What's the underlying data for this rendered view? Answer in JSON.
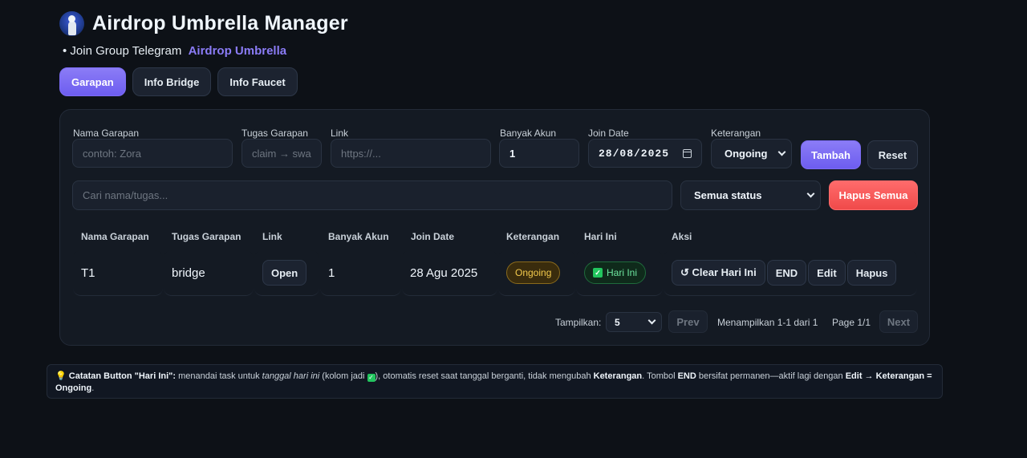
{
  "app": {
    "title": "Airdrop Umbrella Manager",
    "subtitle_prefix": "• Join Group Telegram",
    "subtitle_link": "Airdrop Umbrella"
  },
  "tabs": [
    {
      "label": "Garapan",
      "active": true
    },
    {
      "label": "Info Bridge",
      "active": false
    },
    {
      "label": "Info Faucet",
      "active": false
    }
  ],
  "form": {
    "nama_label": "Nama Garapan",
    "nama_placeholder": "contoh: Zora",
    "tugas_label": "Tugas Garapan",
    "tugas_placeholder": "claim → swa",
    "link_label": "Link",
    "link_placeholder": "https://...",
    "akun_label": "Banyak Akun",
    "akun_value": "1",
    "date_label": "Join Date",
    "date_value": "28/08/2025",
    "ket_label": "Keterangan",
    "ket_value": "Ongoing",
    "add_label": "Tambah",
    "reset_label": "Reset"
  },
  "filter": {
    "search_placeholder": "Cari nama/tugas...",
    "status_value": "Semua status",
    "delete_all_label": "Hapus Semua"
  },
  "table": {
    "headers": [
      "Nama Garapan",
      "Tugas Garapan",
      "Link",
      "Banyak Akun",
      "Join Date",
      "Keterangan",
      "Hari Ini",
      "Aksi"
    ],
    "rows": [
      {
        "nama": "T1",
        "tugas": "bridge",
        "link_label": "Open",
        "akun": "1",
        "join_date": "28 Agu 2025",
        "keterangan": "Ongoing",
        "hari_ini": "Hari Ini",
        "actions": [
          "↺ Clear Hari Ini",
          "END",
          "Edit",
          "Hapus"
        ]
      }
    ]
  },
  "pagination": {
    "show_label": "Tampilkan:",
    "page_size": "5",
    "prev_label": "Prev",
    "summary": "Menampilkan 1-1 dari 1",
    "page_info": "Page 1/1",
    "next_label": "Next"
  },
  "note": {
    "icon": "💡",
    "title": "Catatan Button \"Hari Ini\":",
    "text1": " menandai task untuk ",
    "em": "tanggal hari ini",
    "text2": " (kolom jadi ",
    "text3": "), otomatis reset saat tanggal berganti, tidak mengubah ",
    "b1": "Keterangan",
    "text4": ". Tombol ",
    "b2": "END",
    "text5": " bersifat permanen—aktif lagi dengan ",
    "b3": "Edit → Keterangan = Ongoing",
    "text6": "."
  },
  "colors": {
    "background": "#0d1117",
    "accent": "#7c6cf4",
    "danger": "#f04a4a",
    "ongoing": "#f2c94c",
    "today": "#22c55e"
  }
}
